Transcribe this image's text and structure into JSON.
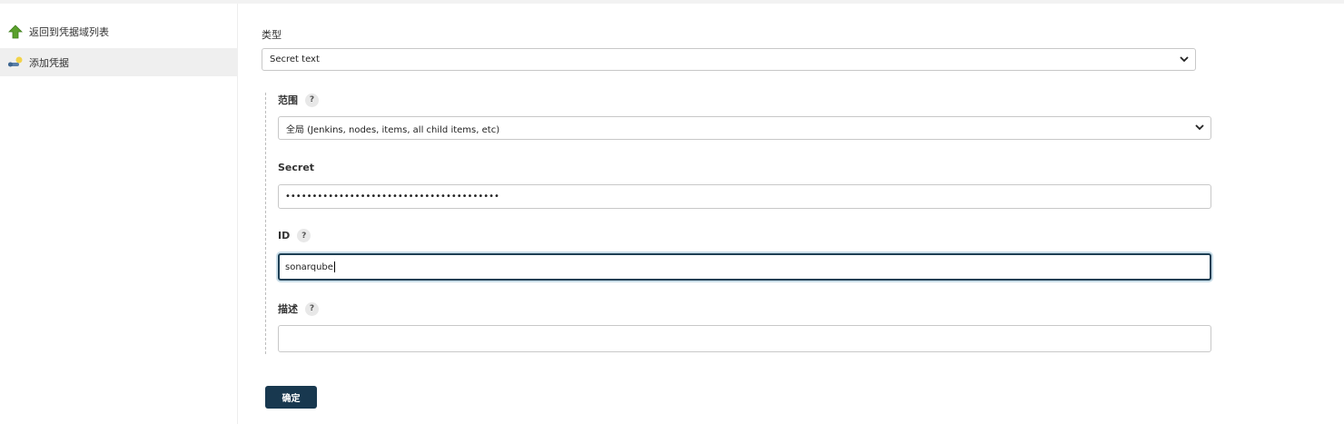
{
  "sidebar": {
    "items": [
      {
        "label": "返回到凭据域列表",
        "icon": "arrow-up-icon"
      },
      {
        "label": "添加凭据",
        "icon": "credentials-key-icon"
      }
    ]
  },
  "form": {
    "kind": {
      "label": "类型",
      "value": "Secret text"
    },
    "scope": {
      "label": "范围",
      "help": "?",
      "value": "全局 (Jenkins, nodes, items, all child items, etc)"
    },
    "secret": {
      "label": "Secret",
      "value": "••••••••••••••••••••••••••••••••••••••••"
    },
    "id": {
      "label": "ID",
      "help": "?",
      "value": "sonarqube"
    },
    "description": {
      "label": "描述",
      "help": "?",
      "value": ""
    },
    "submit_label": "确定"
  },
  "colors": {
    "button": "#18384f",
    "focus_border": "#1e3f54",
    "sidebar_active": "#efefef",
    "arrow_green": "#5aa02c"
  }
}
